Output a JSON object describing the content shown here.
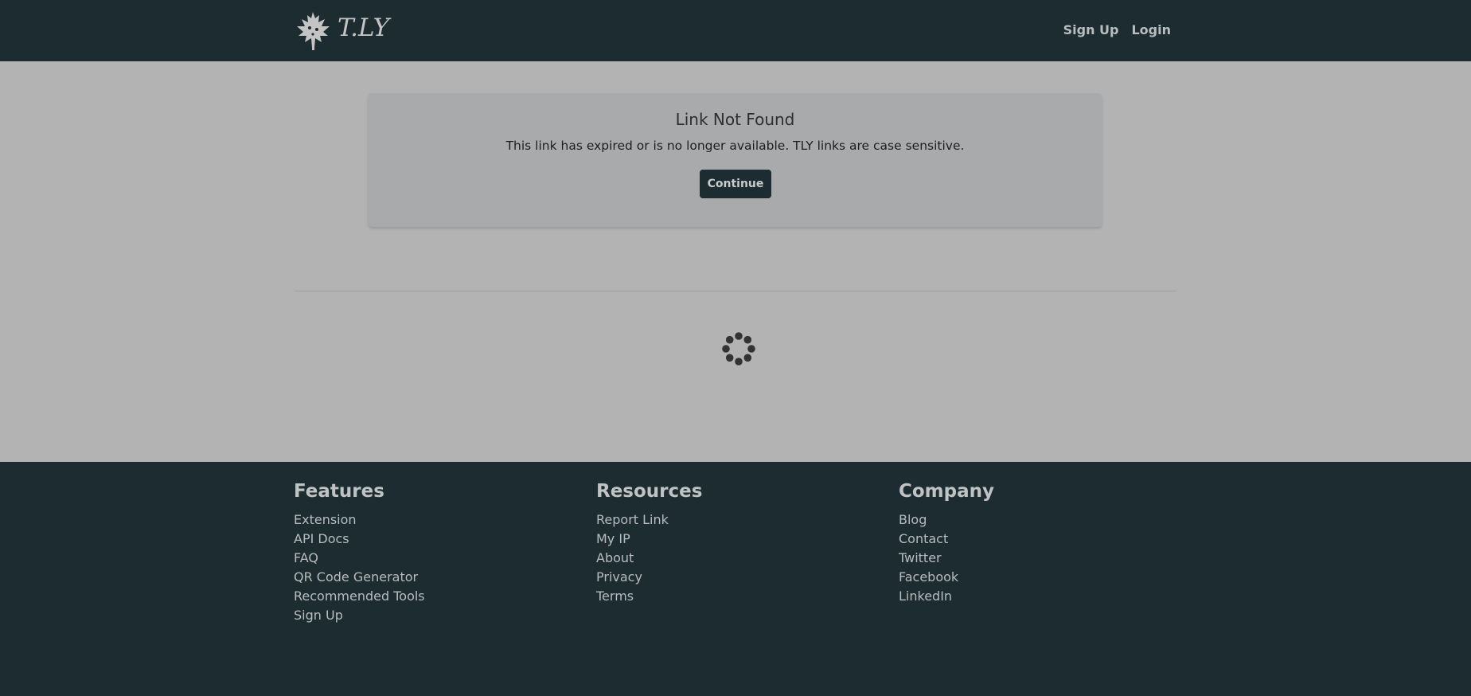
{
  "header": {
    "brand": "T.LY",
    "nav": [
      "Sign Up",
      "Login"
    ]
  },
  "notice": {
    "title": "Link Not Found",
    "message": "This link has expired or is no longer available. TLY links are case sensitive.",
    "button": "Continue"
  },
  "loader": {
    "icon": "spinner-icon"
  },
  "footer": {
    "columns": [
      {
        "heading": "Features",
        "links": [
          "Extension",
          "API Docs",
          "FAQ",
          "QR Code Generator",
          "Recommended Tools",
          "Sign Up"
        ]
      },
      {
        "heading": "Resources",
        "links": [
          "Report Link",
          "My IP",
          "About",
          "Privacy",
          "Terms"
        ]
      },
      {
        "heading": "Company",
        "links": [
          "Blog",
          "Contact",
          "Twitter",
          "Facebook",
          "LinkedIn"
        ]
      }
    ]
  },
  "colors": {
    "dark": "#1c2c30",
    "background": "#b3b3b3",
    "card": "#a8aaac"
  }
}
